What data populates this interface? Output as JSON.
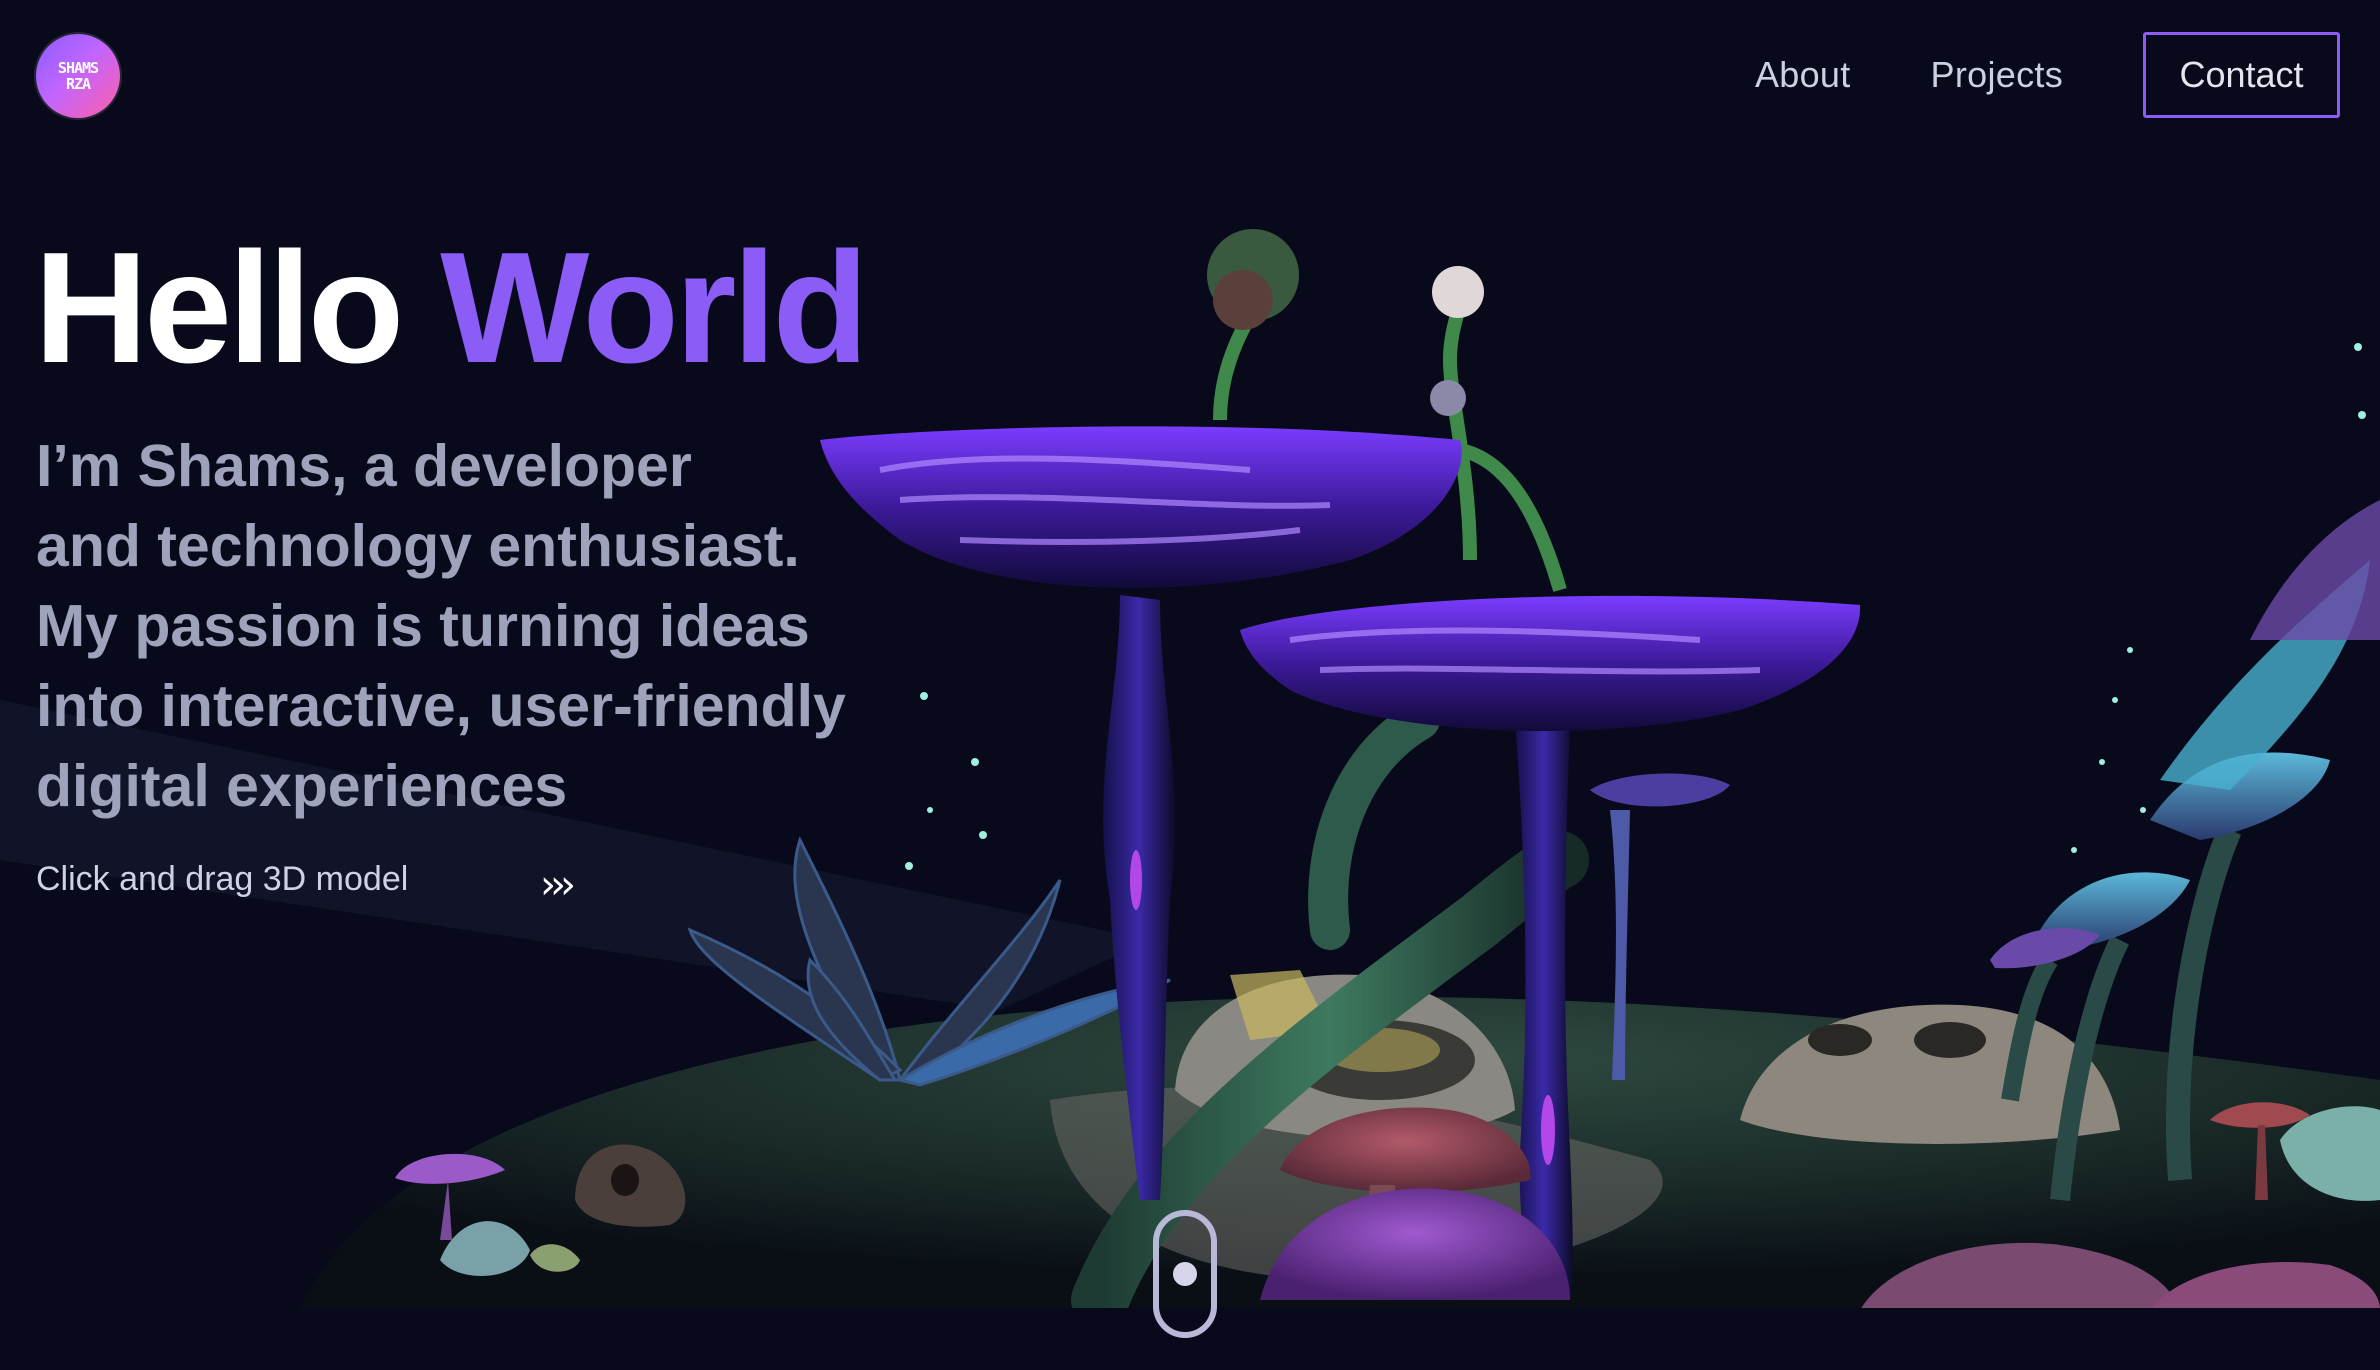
{
  "logo": {
    "line1": "SHAMS",
    "line2": "RZA"
  },
  "nav": {
    "about": "About",
    "projects": "Projects",
    "contact": "Contact"
  },
  "hero": {
    "title_word1": "Hello",
    "title_word2": "World",
    "description_lines": [
      "I’m Shams, a developer",
      "and technology enthusiast.",
      "My passion is turning ideas",
      "into interactive, user-friendly",
      "digital experiences"
    ],
    "hint": "Click and drag 3D model",
    "hint_arrows": "›››"
  },
  "colors": {
    "background": "#080a1b",
    "accent": "#8b5cf6",
    "heading": "#ffffff",
    "body_text": "#9ea3bb"
  },
  "icons": {
    "scroll": "scroll-mouse-icon",
    "drag": "chevrons-right-icon"
  }
}
